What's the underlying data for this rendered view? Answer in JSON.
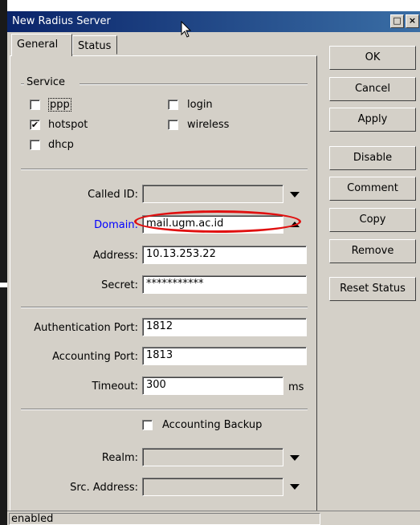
{
  "window": {
    "title": "New Radius Server"
  },
  "tabs": [
    {
      "label": "General",
      "active": true
    },
    {
      "label": "Status",
      "active": false
    }
  ],
  "service": {
    "group_label": "Service",
    "options": [
      {
        "label": "ppp",
        "checked": false
      },
      {
        "label": "login",
        "checked": false
      },
      {
        "label": "hotspot",
        "checked": true
      },
      {
        "label": "wireless",
        "checked": false
      },
      {
        "label": "dhcp",
        "checked": false
      }
    ]
  },
  "fields": {
    "called_id": {
      "label": "Called ID:",
      "value": ""
    },
    "domain": {
      "label": "Domain:",
      "value": "mail.ugm.ac.id"
    },
    "address": {
      "label": "Address:",
      "value": "10.13.253.22"
    },
    "secret": {
      "label": "Secret:",
      "value": "***********"
    },
    "auth_port": {
      "label": "Authentication Port:",
      "value": "1812"
    },
    "acct_port": {
      "label": "Accounting Port:",
      "value": "1813"
    },
    "timeout": {
      "label": "Timeout:",
      "value": "300",
      "unit": "ms"
    },
    "accounting_backup": {
      "label": "Accounting Backup",
      "checked": false
    },
    "realm": {
      "label": "Realm:",
      "value": ""
    },
    "src_address": {
      "label": "Src. Address:",
      "value": ""
    }
  },
  "buttons": {
    "ok": "OK",
    "cancel": "Cancel",
    "apply": "Apply",
    "disable": "Disable",
    "comment": "Comment",
    "copy": "Copy",
    "remove": "Remove",
    "reset_status": "Reset Status"
  },
  "status_bar": {
    "text": "enabled"
  },
  "colors": {
    "titlebar": "#0a246a",
    "domain_label": "#0000ff",
    "annotation": "#e01010",
    "face": "#d4d0c8"
  },
  "icons": {
    "checkmark": "check-icon",
    "dropdown": "triangle-down-icon",
    "cursor": "mouse-pointer-icon"
  }
}
